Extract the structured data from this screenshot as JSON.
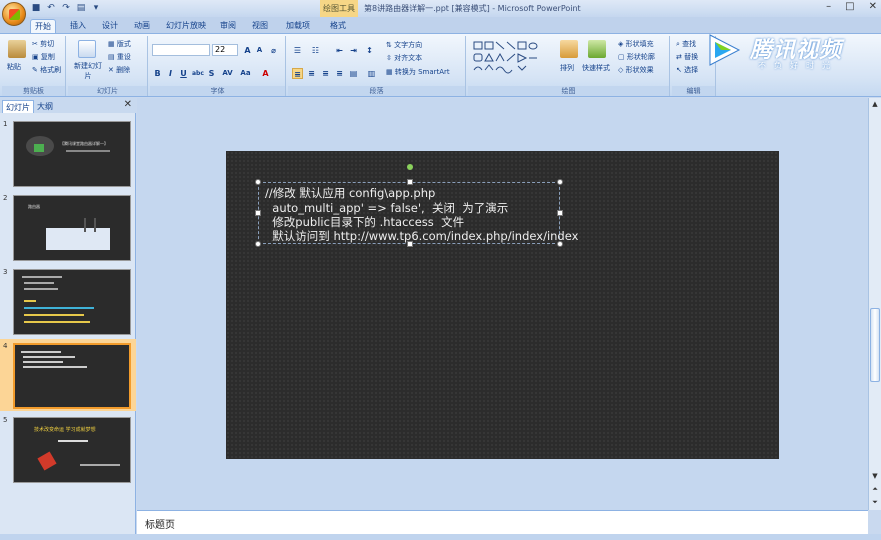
{
  "window": {
    "title": "第8讲路由器详解一.ppt [兼容模式] - Microsoft PowerPoint",
    "context_tab": "绘图工具"
  },
  "ribbon_tabs": [
    "开始",
    "插入",
    "设计",
    "动画",
    "幻灯片放映",
    "审阅",
    "视图",
    "加载项",
    "格式"
  ],
  "ribbon": {
    "clipboard": {
      "paste": "粘贴",
      "cut": "剪切",
      "copy": "复制",
      "format_painter": "格式刷",
      "label": "剪贴板"
    },
    "slides": {
      "new_slide": "新建幻灯片",
      "layout": "版式",
      "reset": "重设",
      "delete": "删除",
      "label": "幻灯片"
    },
    "font": {
      "font_size": "22",
      "label": "字体"
    },
    "paragraph": {
      "text_direction": "文字方向",
      "align_text": "对齐文本",
      "smartart": "转换为 SmartArt",
      "label": "段落"
    },
    "drawing": {
      "arrange": "排列",
      "quick_styles": "快速样式",
      "shape_fill": "形状填充",
      "shape_outline": "形状轮廓",
      "shape_effects": "形状效果",
      "label": "绘图"
    },
    "editing": {
      "find": "查找",
      "replace": "替换",
      "select": "选择",
      "label": "编辑"
    }
  },
  "watermark": {
    "brand": "腾讯视频",
    "slogan": "不负好时光"
  },
  "left_panel": {
    "tab_slides": "幻灯片",
    "tab_outline": "大纲",
    "thumbnails": [
      {
        "num": "1",
        "text": "【腾讯课堂路由器详解一】"
      },
      {
        "num": "2",
        "text": "路由器"
      },
      {
        "num": "3",
        "text": "代码示例"
      },
      {
        "num": "4",
        "text": "//修改 默认应用 config\\app.php"
      },
      {
        "num": "5",
        "text": "技术改变命运    学习成就梦想"
      }
    ]
  },
  "slide": {
    "lines": [
      "//修改 默认应用 config\\app.php",
      "  auto_multi_app' => false',  关闭  为了演示",
      "  修改public目录下的 .htaccess  文件",
      "  默认访问到 http://www.tp6.com/index.php/index/index"
    ]
  },
  "notes": {
    "text": "标题页"
  }
}
